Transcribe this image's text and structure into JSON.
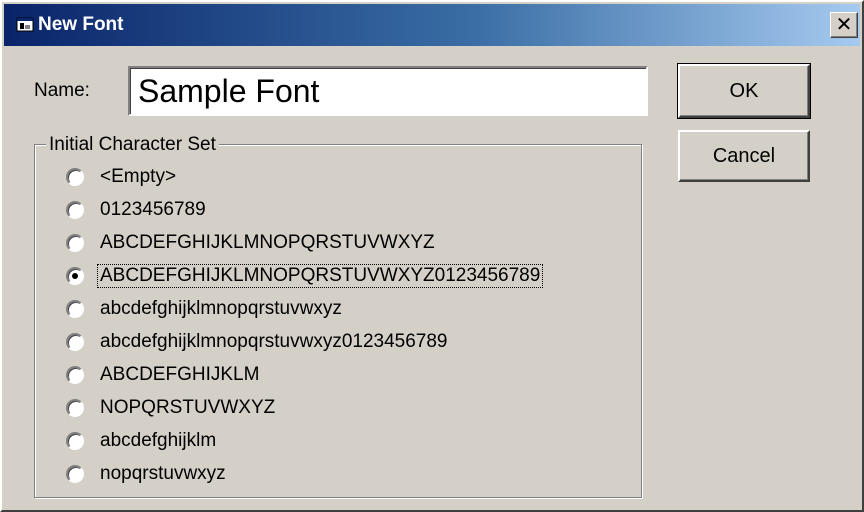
{
  "dialog": {
    "title": "New Font",
    "close_glyph": "✕",
    "title_icon": "font-app-icon"
  },
  "name": {
    "label": "Name:",
    "value": "Sample Font"
  },
  "buttons": {
    "ok": "OK",
    "cancel": "Cancel"
  },
  "charset": {
    "legend": "Initial Character Set",
    "selected_index": 3,
    "options": [
      "<Empty>",
      "0123456789",
      "ABCDEFGHIJKLMNOPQRSTUVWXYZ",
      "ABCDEFGHIJKLMNOPQRSTUVWXYZ0123456789",
      "abcdefghijklmnopqrstuvwxyz",
      "abcdefghijklmnopqrstuvwxyz0123456789",
      "ABCDEFGHIJKLM",
      "NOPQRSTUVWXYZ",
      "abcdefghijklm",
      "nopqrstuvwxyz"
    ]
  },
  "colors": {
    "titlebar_start": "#0a246a",
    "titlebar_end": "#a6caf0",
    "face": "#d4d0c8"
  }
}
